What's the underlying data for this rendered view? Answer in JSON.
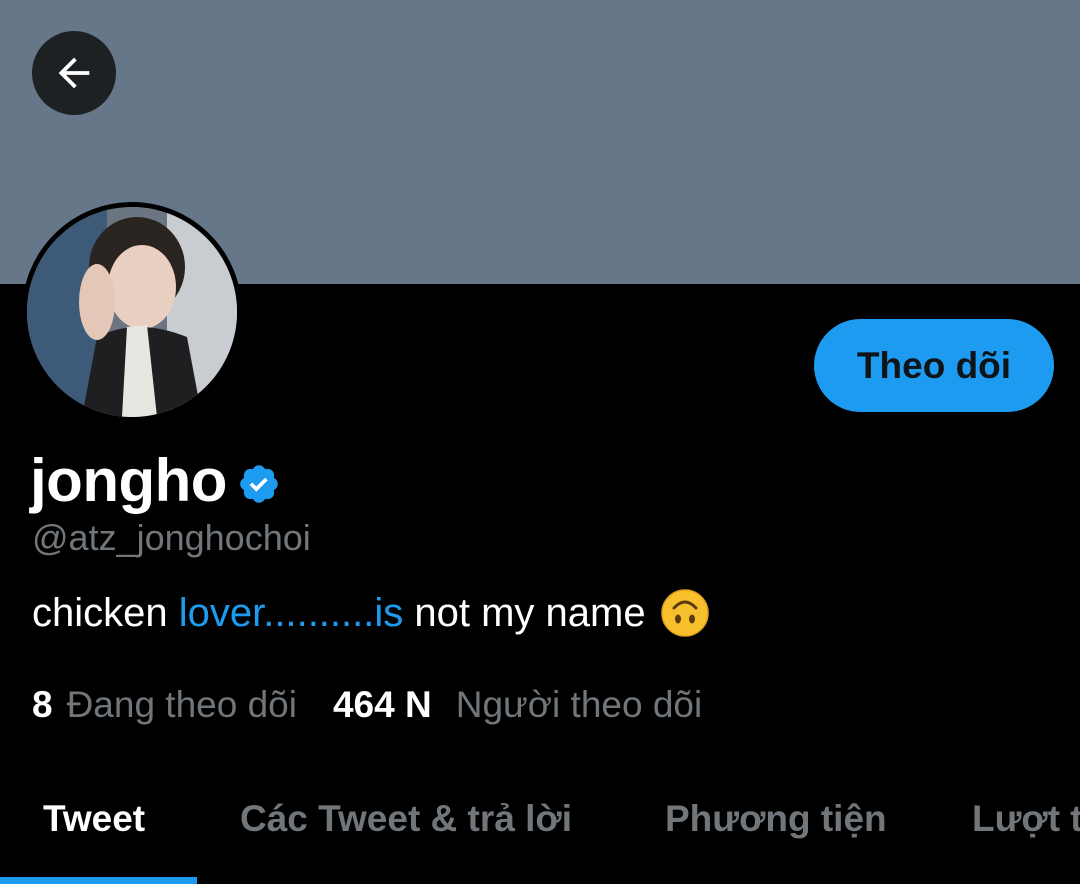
{
  "header": {
    "back_icon": "arrow-left-icon",
    "banner_color": "#66778a"
  },
  "profile": {
    "display_name": "jongho",
    "verified_icon": "verified-badge-icon",
    "handle": "@atz_jonghochoi",
    "follow_label": "Theo dõi",
    "bio": {
      "prefix": "chicken ",
      "link_text": "lover..........is",
      "suffix": " not my name",
      "emoji": "upside-down-face-emoji"
    },
    "stats": {
      "following_count": "8",
      "following_label": "Đang theo dõi",
      "followers_count": "464 N",
      "followers_label": "Người theo dõi"
    }
  },
  "tabs": [
    {
      "label": "Tweet",
      "active": true
    },
    {
      "label": "Các Tweet & trả lời",
      "active": false
    },
    {
      "label": "Phương tiện",
      "active": false
    },
    {
      "label": "Lượt t",
      "active": false
    }
  ],
  "colors": {
    "accent": "#1d9bf0",
    "background": "#000000",
    "secondary_text": "#71767b"
  }
}
